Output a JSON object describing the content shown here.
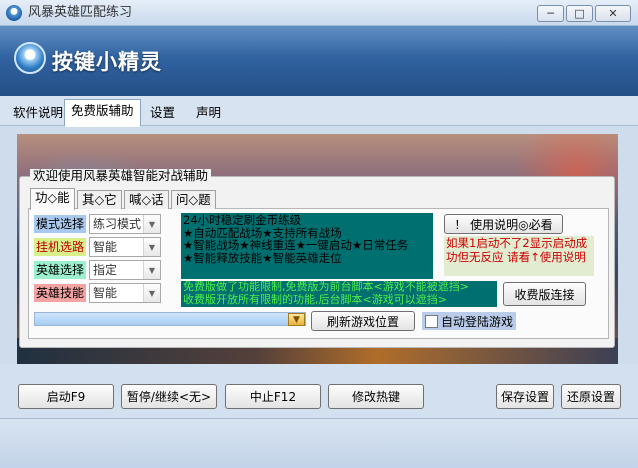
{
  "window": {
    "title": "风暴英雄匹配练习"
  },
  "banner": {
    "logo_text": "按键小精灵",
    "logo_icon": "app-logo-icon"
  },
  "tabs": [
    {
      "label": "软件说明"
    },
    {
      "label": "免费版辅助"
    },
    {
      "label": "设置"
    },
    {
      "label": "声明"
    }
  ],
  "group": {
    "title": "欢迎使用风暴英雄智能对战辅助",
    "tabs": [
      {
        "label": "功◇能"
      },
      {
        "label": "其◇它"
      },
      {
        "label": "喊◇话"
      },
      {
        "label": "问◇题"
      }
    ]
  },
  "form": {
    "mode_label": "模式选择",
    "mode_value": "练习模式",
    "server_label": "挂机选路",
    "server_value": "智能",
    "hero_label": "英雄选择",
    "hero_value": "指定",
    "skill_label": "英雄技能",
    "skill_value": "智能"
  },
  "info_lines": [
    "24小时稳定刷金币练级",
    "★自动匹配战场★支持所有战场",
    "★智能战场★神线重连★一键启动★日常任务",
    "★智能释放技能★智能英雄走位"
  ],
  "help_button": "！ 使用说明◎必看",
  "warning_lines": [
    "如果1启动不了2显示启动成",
    "功但无反应 请看↑使用说明"
  ],
  "promo_lines": [
    "免费版做了功能限制,免费版为前台脚本<游戏不能被遮挡>",
    "收费版开放所有限制的功能,后台脚本<游戏可以遮挡>"
  ],
  "paid_button": "收费版连接",
  "refresh_button": "刷新游戏位置",
  "auto_login_label": "自动登陆游戏",
  "bottom_buttons": {
    "start": "启动F9",
    "pause": "暂停/继续<无>",
    "stop": "中止F12",
    "hotkey": "修改热键",
    "save": "保存设置",
    "restore": "还原设置"
  },
  "colors": {
    "info_bg": "#006f6f",
    "promo_text": "#4cf04c",
    "warning_text": "#cc0000"
  }
}
